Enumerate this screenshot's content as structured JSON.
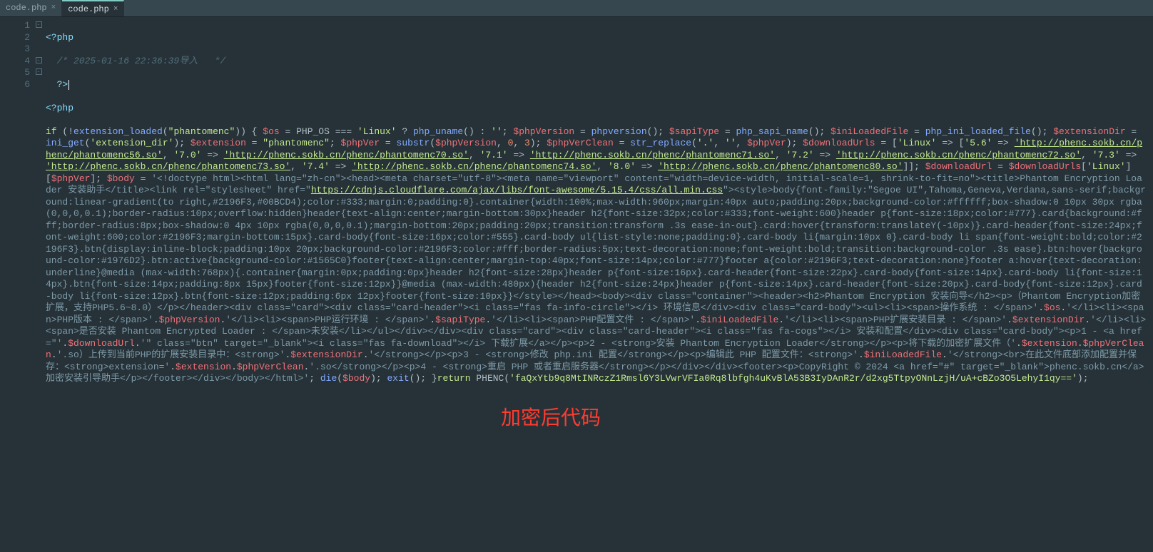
{
  "tabs": [
    {
      "label": "code.php",
      "active": false
    },
    {
      "label": "code.php",
      "active": true
    }
  ],
  "gutter": [
    "1",
    "2",
    "3",
    "4",
    "5",
    "",
    "",
    "",
    "",
    "",
    "",
    "",
    "",
    "",
    "",
    "",
    "",
    "",
    "",
    "",
    "",
    "",
    "",
    "",
    "",
    "",
    "",
    "",
    "6"
  ],
  "fold": [
    "-",
    "",
    "",
    "-",
    "-",
    "",
    "",
    "",
    "",
    "",
    "",
    "",
    "",
    "",
    "",
    "",
    "",
    "",
    "",
    "",
    "",
    "",
    "",
    "",
    "",
    "",
    "",
    "",
    ""
  ],
  "lines": {
    "l1": "<?php",
    "l2a": "/* 2025-01-16 22:36:39",
    "l2b": "导入   */",
    "l3": "?>",
    "l4": "<?php",
    "l5_if": "if",
    "l5_a": " (!",
    "l5_ext": "extension_loaded",
    "l5_b": "(",
    "l5_s1": "\"phantomenc\"",
    "l5_c": ")) { ",
    "l5_v1": "$os",
    "l5_d": " = PHP_OS === ",
    "l5_s2": "'Linux'",
    "l5_e": " ? ",
    "l5_fn2": "php_uname",
    "l5_f": "() : ",
    "l5_s3": "''",
    "l5_g": "; ",
    "l5_v2": "$phpVersion",
    "l5_h": " = ",
    "l5_fn3": "phpversion",
    "l5_i": "(); ",
    "l5_v3": "$sapiType",
    "l5_j": " = ",
    "l5_fn4": "php_sapi_name",
    "l5_k": "(); ",
    "l5_v4": "$iniLoadedFile",
    "l5_l": " = ",
    "l5_fn5": "php_ini_loaded_file",
    "l5_m": "(); ",
    "l5_v5": "$extensionDir",
    "l5_n": " = ",
    "l5_fn6": "ini_get",
    "l5_o": "(",
    "w2_s1": "'extension_dir'",
    "w2_a": "); ",
    "w2_v1": "$extension",
    "w2_b": " = ",
    "w2_s2": "\"phantomenc\"",
    "w2_c": "; ",
    "w2_v2": "$phpVer",
    "w2_d": " = ",
    "w2_fn1": "substr",
    "w2_e": "(",
    "w2_v3": "$phpVersion",
    "w2_f": ", ",
    "w2_n1": "0",
    "w2_g": ", ",
    "w2_n2": "3",
    "w2_h": "); ",
    "w2_v4": "$phpVerClean",
    "w2_i": " = ",
    "w2_fn2": "str_replace",
    "w2_j": "(",
    "w2_s3": "'.'",
    "w2_k": ", ",
    "w2_s4": "''",
    "w2_l": ", ",
    "w2_v5": "$phpVer",
    "w2_m": "); ",
    "w2_v6": "$downloadUrls",
    "w2_n": " = [",
    "w2_s5": "'Linux'",
    "w2_o": " => [",
    "w2_s6": "'5.6'",
    "w2_p": " => ",
    "w2_u1": "'http://phenc.sokb.cn/phenc/phantomenc56.so'",
    "w2_q": ",",
    "w3_s1": "'7.0'",
    "w3_a": " => ",
    "w3_u1": "'http://phenc.sokb.cn/phenc/phantomenc70.so'",
    "w3_b": ", ",
    "w3_s2": "'7.1'",
    "w3_c": " => ",
    "w3_u2": "'http://phenc.sokb.cn/phenc/phantomenc71.so'",
    "w3_d": ", ",
    "w3_s3": "'7.2'",
    "w3_e": " => ",
    "w3_u3": "'http://phenc.sokb.cn/phenc/phantomenc72.so'",
    "w3_f": ", ",
    "w3_s4": "'7.3'",
    "w3_g": " =>",
    "w4_u1": "'http://phenc.sokb.cn/phenc/phantomenc73.so'",
    "w4_a": ", ",
    "w4_s1": "'7.4'",
    "w4_b": " => ",
    "w4_u2": "'http://phenc.sokb.cn/phenc/phantomenc74.so'",
    "w4_c": ", ",
    "w4_s2": "'8.0'",
    "w4_d": " => ",
    "w4_u3": "'http://phenc.sokb.cn/phenc/phantomenc80.so'",
    "w4_e": "]]; ",
    "w4_v1": "$downloadUrl",
    "w4_f": " = ",
    "w4_v2": "$downloadUrls",
    "w4_g": "[",
    "w4_s3": "'Linux'",
    "w4_h": "][",
    "w4_v3": "$phpVer",
    "w4_i": "]; ",
    "w4_v4": "$body",
    "w5_a": " = ",
    "w5_s1": "'<!doctype html><html lang=\"zh-cn\"><head><meta charset=\"utf-8\"><meta name=\"viewport\" content=\"width=device-width, initial-scale=1, shrink-to-fit=no\"><title>Phantom Encryption Loader 安装助手</title><link rel=\"stylesheet\" href=\"",
    "w5_u1": "https://cdnjs.cloudflare.com/ajax/libs/font-awesome/5.15.4/css/all.min.css",
    "w5_s2": "\"><style>body{font-family:\"Segoe UI\",Tahoma,Geneva,Verdana,sans-serif;background:linear-gradient(to right,#2196F3,#00BCD4);color:#333;margin:0;padding:0}.container{width:100%;max-width:960px;margin:40px auto;padding:20px;background-color:#ffffff;box-shadow:0 10px 30px rgba(0,0,0,0.1);border-radius:10px;overflow:hidden}header{text-align:center;margin-bottom:30px}header h2{font-size:32px;color:#333;font-weight:600}header p{font-size:18px;color:#777}.card{background:#fff;border-radius:8px;box-shadow:0 4px 10px rgba(0,0,0,0.1);margin-bottom:20px;padding:20px;transition:transform .3s ease-in-out}.card:hover{transform:translateY(-10px)}.card-header{font-size:24px;font-weight:600;color:#2196F3;margin-bottom:15px}.card-body{font-size:16px;color:#555}.card-body ul{list-style:none;padding:0}.card-body li{margin:10px 0}.card-body li span{font-weight:bold;color:#2196F3}.btn{display:inline-block;padding:10px 20px;background-color:#2196F3;color:#fff;border-radius:5px;text-decoration:none;font-weight:bold;transition:background-color .3s ease}.btn:hover{background-color:#1976D2}.btn:active{background-color:#1565C0}footer{text-align:center;margin-top:40px;font-size:14px;color:#777}footer a{color:#2196F3;text-decoration:none}footer a:hover{text-decoration:underline}@media (max-width:768px){.container{margin:0px;padding:0px}header h2{font-size:28px}header p{font-size:16px}.card-header{font-size:22px}.card-body{font-size:14px}.card-body li{font-size:14px}.btn{font-size:14px;padding:8px 15px}footer{font-size:12px}}@media (max-width:480px){header h2{font-size:24px}header p{font-size:14px}.card-header{font-size:20px}.card-body{font-size:12px}.card-body li{font-size:12px}.btn{font-size:12px;padding:6px 12px}footer{font-size:10px}}</style></head><body><div class=\"container\"><header><h2>Phantom Encryption 安装向导</h2><p>（Phantom Encryption加密扩展，支持PHP5.6~8.0）</p></header><div class=\"card\"><div class=\"card-header\"><i class=\"fas fa-info-circle\"></i> 环境信息</div><div class=\"card-body\"><ul><li><span>操作系统 : </span>'",
    "w5_b1": ".",
    "w5_v1": "$os",
    "w5_b2": ".",
    "w5_s3": "'</li><li><span>PHP版本 : </span>'",
    "w5_b3": ".",
    "w5_v2": "$phpVersion",
    "w5_b4": ".",
    "w5_s4": "'</li><li><span>PHP运行环境 : </span>'",
    "w5_b5": ".",
    "w5_v3": "$sapiType",
    "w5_b6": ".",
    "w5_s5": "'</li><li><span>PHP配置文件 : </span>'",
    "w5_b7": ".",
    "w6_v1": "$iniLoadedFile",
    "w6_a": ".",
    "w6_s1": "'</li><li><span>PHP扩展安装目录 : </span>'",
    "w6_b": ".",
    "w6_v2": "$extensionDir",
    "w6_c": ".",
    "w6_s2": "'</li><li><span>是否安装 Phantom Encrypted Loader : </span>未安装</li></ul></div></div><div class=\"card\"><div class=\"card-header\"><i class=\"fas fa-cogs\"></i> 安装和配置</div><div class=\"card-body\"><p>1 - <a href=\"'",
    "w6_d": ".",
    "w6_v3": "$downloadUrl",
    "w6_e": ".",
    "w6_s3": "'\" class=\"btn\" target=\"_blank\"><i class=\"fas fa-download\"></i> 下载扩展</a></p><p>2 - <strong>安装 Phantom Encryption Loader</strong></p><p>将下载的加密扩展文件（'",
    "w6_f": ".",
    "w6_v4": "$extension",
    "w6_g": ".",
    "w6_v5": "$phpVerClean",
    "w6_h": ".",
    "w6_s4": "'.so）上传到当前PHP的扩展安装目录中：<strong>'",
    "w6_i": ".",
    "w6_v6": "$extensionDir",
    "w6_j": ".",
    "w6_s5": "'</strong></p><p>3 - <strong>修改 php.ini 配置</strong></p><p>编辑此 PHP 配置文件：<strong>'",
    "w6_k": ".",
    "w6_v7": "$iniLoadedFile",
    "w6_l": ".",
    "w6_s6": "'</strong><br>在此文件底部添加配置并保存：<strong>extension='",
    "w6_m": ".",
    "w6_v8": "$extension",
    "w6_n": ".",
    "w6_v9": "$phpVerClean",
    "w6_o": ".",
    "w6_s7": "'.so</strong></p><p>4 - <strong>重启 PHP 或者重启服务器</strong></p></div></div><footer><p>CopyRight © 2024 <a href=\"#\" target=\"_blank\">phenc.sokb.cn</a> 加密安装引导助手</p></footer></div></body></html>'",
    "w7_a": "; ",
    "w7_fn1": "die",
    "w7_b": "(",
    "w7_v1": "$body",
    "w7_c": "); ",
    "w7_fn2": "exit",
    "w7_d": "(); }",
    "w7_ret": "return",
    "w7_e": " PHENC(",
    "w8_s1": "'faQxYtb9q8MtINRczZ1Rmsl6Y3LVwrVFIa0Rq8lbfgh4uKvBlA53B3IyDAnR2r/d2xg5TtpyONnLzjH/uA+cBZo3O5LehyI1qy=='",
    "w8_a": ");"
  },
  "overlay": "加密后代码"
}
